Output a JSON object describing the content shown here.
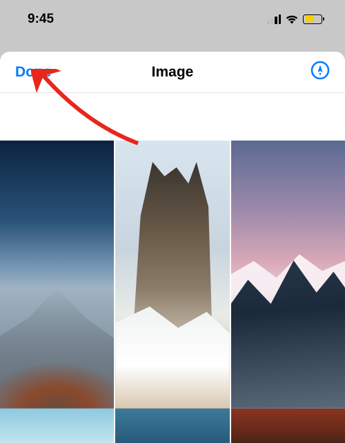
{
  "status_bar": {
    "time": "9:45"
  },
  "nav": {
    "done_label": "Done",
    "title": "Image"
  },
  "colors": {
    "accent": "#007aff",
    "battery_fill": "#ffcc00"
  }
}
